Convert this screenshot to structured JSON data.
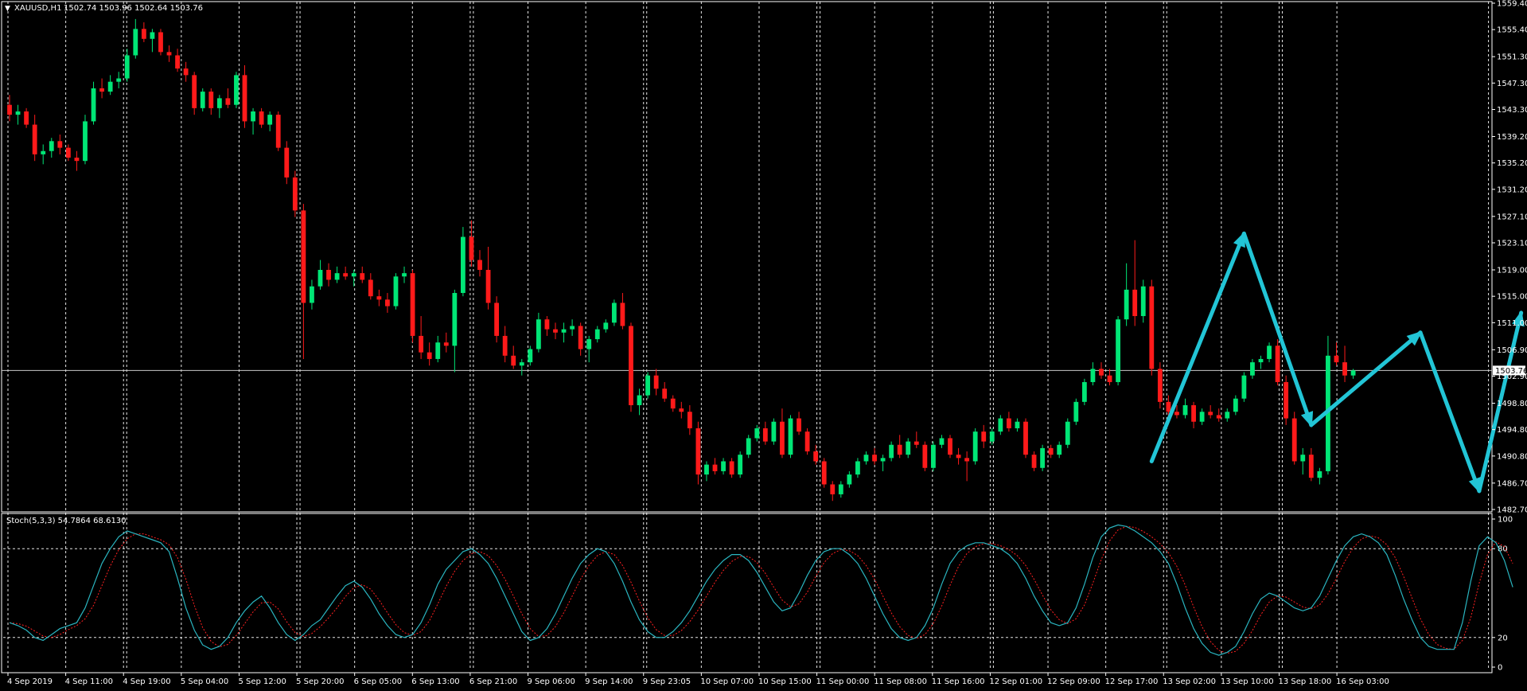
{
  "chart_data": {
    "type": "candlestick",
    "symbol_label": "XAUUSD,H1",
    "ohlc_readout": "1502.74 1503.96 1502.64 1503.76",
    "price_axis": {
      "range": [
        1482.7,
        1559.4
      ],
      "ticks": [
        1482.7,
        1486.7,
        1490.8,
        1494.8,
        1498.8,
        1502.9,
        1506.9,
        1511.0,
        1515.0,
        1519.0,
        1523.1,
        1527.1,
        1531.2,
        1535.2,
        1539.2,
        1543.3,
        1547.3,
        1551.3,
        1555.4,
        1559.4
      ],
      "current_price": 1503.76,
      "current_price_label": "1503.76"
    },
    "time_axis": {
      "labels": [
        "4 Sep 2019",
        "4 Sep 11:00",
        "4 Sep 19:00",
        "5 Sep 04:00",
        "5 Sep 12:00",
        "5 Sep 20:00",
        "6 Sep 05:00",
        "6 Sep 13:00",
        "6 Sep 21:00",
        "9 Sep 06:00",
        "9 Sep 14:00",
        "9 Sep 23:05",
        "10 Sep 07:00",
        "10 Sep 15:00",
        "11 Sep 00:00",
        "11 Sep 08:00",
        "11 Sep 16:00",
        "12 Sep 01:00",
        "12 Sep 09:00",
        "12 Sep 17:00",
        "13 Sep 02:00",
        "13 Sep 10:00",
        "13 Sep 18:00",
        "16 Sep 03:00"
      ],
      "grid_label_indices": [
        2,
        5,
        8,
        11,
        14,
        17,
        20,
        22
      ],
      "extra_grid_after_end": true
    },
    "candles": [
      [
        1544.0,
        1545.5,
        1541.5,
        1542.5
      ],
      [
        1542.5,
        1544.0,
        1541.0,
        1543.0
      ],
      [
        1543.0,
        1543.5,
        1540.5,
        1541.0
      ],
      [
        1541.0,
        1542.5,
        1535.5,
        1536.5
      ],
      [
        1536.5,
        1538.0,
        1535.0,
        1537.0
      ],
      [
        1537.0,
        1539.0,
        1536.0,
        1538.5
      ],
      [
        1538.5,
        1539.5,
        1536.5,
        1537.5
      ],
      [
        1537.5,
        1538.0,
        1535.5,
        1536.0
      ],
      [
        1536.0,
        1537.0,
        1534.0,
        1535.5
      ],
      [
        1535.5,
        1542.5,
        1535.0,
        1541.5
      ],
      [
        1541.5,
        1547.5,
        1541.0,
        1546.5
      ],
      [
        1546.5,
        1548.0,
        1545.0,
        1546.0
      ],
      [
        1546.0,
        1548.5,
        1545.5,
        1547.5
      ],
      [
        1547.5,
        1549.0,
        1546.5,
        1548.0
      ],
      [
        1548.0,
        1552.5,
        1547.5,
        1551.5
      ],
      [
        1551.5,
        1557.0,
        1551.0,
        1555.5
      ],
      [
        1555.5,
        1556.5,
        1553.5,
        1554.0
      ],
      [
        1554.0,
        1555.5,
        1552.0,
        1555.0
      ],
      [
        1555.0,
        1555.5,
        1551.5,
        1552.0
      ],
      [
        1552.0,
        1553.0,
        1550.5,
        1551.5
      ],
      [
        1551.5,
        1552.5,
        1549.0,
        1549.5
      ],
      [
        1549.5,
        1550.5,
        1547.5,
        1548.5
      ],
      [
        1548.5,
        1549.0,
        1542.5,
        1543.5
      ],
      [
        1543.5,
        1546.5,
        1543.0,
        1546.0
      ],
      [
        1546.0,
        1546.5,
        1542.5,
        1543.5
      ],
      [
        1543.5,
        1545.5,
        1542.0,
        1545.0
      ],
      [
        1545.0,
        1546.5,
        1543.5,
        1544.0
      ],
      [
        1544.0,
        1549.0,
        1543.5,
        1548.5
      ],
      [
        1548.5,
        1550.0,
        1540.5,
        1541.5
      ],
      [
        1541.5,
        1543.5,
        1539.5,
        1543.0
      ],
      [
        1543.0,
        1543.5,
        1540.5,
        1541.0
      ],
      [
        1541.0,
        1543.0,
        1540.0,
        1542.5
      ],
      [
        1542.5,
        1543.0,
        1537.0,
        1537.5
      ],
      [
        1537.5,
        1538.5,
        1532.0,
        1533.0
      ],
      [
        1533.0,
        1534.0,
        1527.0,
        1528.0
      ],
      [
        1528.0,
        1529.0,
        1505.5,
        1514.0
      ],
      [
        1514.0,
        1517.5,
        1513.0,
        1516.5
      ],
      [
        1516.5,
        1520.5,
        1516.0,
        1519.0
      ],
      [
        1519.0,
        1520.0,
        1516.5,
        1517.5
      ],
      [
        1517.5,
        1519.5,
        1517.0,
        1518.5
      ],
      [
        1518.5,
        1519.5,
        1517.5,
        1518.0
      ],
      [
        1518.0,
        1519.0,
        1516.5,
        1518.5
      ],
      [
        1518.5,
        1519.5,
        1517.0,
        1517.5
      ],
      [
        1517.5,
        1518.5,
        1514.5,
        1515.0
      ],
      [
        1515.0,
        1516.0,
        1513.5,
        1514.5
      ],
      [
        1514.5,
        1515.5,
        1512.5,
        1513.5
      ],
      [
        1513.5,
        1518.5,
        1513.0,
        1518.0
      ],
      [
        1518.0,
        1519.5,
        1517.0,
        1518.5
      ],
      [
        1518.5,
        1519.0,
        1508.0,
        1509.0
      ],
      [
        1509.0,
        1512.0,
        1505.5,
        1506.5
      ],
      [
        1506.5,
        1508.0,
        1504.5,
        1505.5
      ],
      [
        1505.5,
        1509.0,
        1505.0,
        1508.0
      ],
      [
        1508.0,
        1509.5,
        1506.5,
        1507.5
      ],
      [
        1507.5,
        1516.0,
        1503.5,
        1515.5
      ],
      [
        1515.5,
        1525.5,
        1515.0,
        1524.0
      ],
      [
        1524.0,
        1526.5,
        1519.5,
        1520.5
      ],
      [
        1520.5,
        1522.0,
        1518.0,
        1519.0
      ],
      [
        1519.0,
        1522.5,
        1513.0,
        1514.0
      ],
      [
        1514.0,
        1515.0,
        1508.0,
        1509.0
      ],
      [
        1509.0,
        1510.5,
        1505.0,
        1506.0
      ],
      [
        1506.0,
        1507.5,
        1504.0,
        1504.5
      ],
      [
        1504.5,
        1505.5,
        1503.0,
        1505.0
      ],
      [
        1505.0,
        1507.5,
        1504.5,
        1507.0
      ],
      [
        1507.0,
        1512.5,
        1506.5,
        1511.5
      ],
      [
        1511.5,
        1512.0,
        1509.0,
        1510.0
      ],
      [
        1510.0,
        1511.0,
        1508.5,
        1509.5
      ],
      [
        1509.5,
        1511.0,
        1508.0,
        1510.0
      ],
      [
        1510.0,
        1511.5,
        1509.0,
        1510.5
      ],
      [
        1510.5,
        1511.0,
        1506.0,
        1507.0
      ],
      [
        1507.0,
        1509.0,
        1505.0,
        1508.5
      ],
      [
        1508.5,
        1510.5,
        1508.0,
        1510.0
      ],
      [
        1510.0,
        1511.5,
        1509.5,
        1511.0
      ],
      [
        1511.0,
        1514.5,
        1510.5,
        1514.0
      ],
      [
        1514.0,
        1515.5,
        1510.0,
        1510.5
      ],
      [
        1510.5,
        1511.0,
        1497.5,
        1498.5
      ],
      [
        1498.5,
        1501.0,
        1497.0,
        1500.0
      ],
      [
        1500.0,
        1503.5,
        1499.5,
        1503.0
      ],
      [
        1503.0,
        1504.0,
        1500.0,
        1501.0
      ],
      [
        1501.0,
        1502.0,
        1499.0,
        1499.5
      ],
      [
        1499.5,
        1500.0,
        1497.5,
        1498.0
      ],
      [
        1498.0,
        1499.0,
        1496.5,
        1497.5
      ],
      [
        1497.5,
        1498.5,
        1494.0,
        1495.0
      ],
      [
        1495.0,
        1496.0,
        1486.5,
        1488.0
      ],
      [
        1488.0,
        1490.0,
        1487.0,
        1489.5
      ],
      [
        1489.5,
        1490.5,
        1488.0,
        1488.5
      ],
      [
        1488.5,
        1490.5,
        1488.0,
        1490.0
      ],
      [
        1490.0,
        1490.5,
        1487.5,
        1488.0
      ],
      [
        1488.0,
        1491.5,
        1487.5,
        1491.0
      ],
      [
        1491.0,
        1494.0,
        1490.5,
        1493.5
      ],
      [
        1493.5,
        1495.5,
        1493.0,
        1495.0
      ],
      [
        1495.0,
        1496.0,
        1492.5,
        1493.0
      ],
      [
        1493.0,
        1496.5,
        1492.5,
        1496.0
      ],
      [
        1496.0,
        1498.0,
        1490.5,
        1491.0
      ],
      [
        1491.0,
        1497.0,
        1490.5,
        1496.5
      ],
      [
        1496.5,
        1497.5,
        1494.0,
        1494.5
      ],
      [
        1494.5,
        1495.0,
        1491.0,
        1491.5
      ],
      [
        1491.5,
        1492.5,
        1489.5,
        1490.0
      ],
      [
        1490.0,
        1490.5,
        1486.0,
        1486.5
      ],
      [
        1486.5,
        1487.0,
        1484.0,
        1485.0
      ],
      [
        1485.0,
        1487.0,
        1484.5,
        1486.5
      ],
      [
        1486.5,
        1488.5,
        1486.0,
        1488.0
      ],
      [
        1488.0,
        1490.5,
        1487.5,
        1490.0
      ],
      [
        1490.0,
        1491.5,
        1489.5,
        1491.0
      ],
      [
        1491.0,
        1492.0,
        1489.5,
        1490.0
      ],
      [
        1490.0,
        1491.0,
        1488.5,
        1490.5
      ],
      [
        1490.5,
        1493.0,
        1490.0,
        1492.5
      ],
      [
        1492.5,
        1494.0,
        1490.5,
        1491.0
      ],
      [
        1491.0,
        1493.5,
        1490.5,
        1493.0
      ],
      [
        1493.0,
        1494.5,
        1492.0,
        1492.5
      ],
      [
        1492.5,
        1493.0,
        1488.5,
        1489.0
      ],
      [
        1489.0,
        1493.0,
        1488.5,
        1492.5
      ],
      [
        1492.5,
        1494.0,
        1492.0,
        1493.5
      ],
      [
        1493.5,
        1494.0,
        1490.5,
        1491.0
      ],
      [
        1491.0,
        1492.0,
        1489.5,
        1490.5
      ],
      [
        1490.5,
        1491.5,
        1487.0,
        1490.0
      ],
      [
        1490.0,
        1495.0,
        1489.5,
        1494.5
      ],
      [
        1494.5,
        1495.5,
        1492.0,
        1493.0
      ],
      [
        1493.0,
        1495.0,
        1492.5,
        1494.5
      ],
      [
        1494.5,
        1497.0,
        1494.0,
        1496.5
      ],
      [
        1496.5,
        1497.5,
        1494.5,
        1495.0
      ],
      [
        1495.0,
        1496.5,
        1494.5,
        1496.0
      ],
      [
        1496.0,
        1496.5,
        1490.5,
        1491.0
      ],
      [
        1491.0,
        1491.5,
        1488.5,
        1489.0
      ],
      [
        1489.0,
        1492.5,
        1488.5,
        1492.0
      ],
      [
        1492.0,
        1492.5,
        1490.5,
        1491.0
      ],
      [
        1491.0,
        1493.0,
        1490.5,
        1492.5
      ],
      [
        1492.5,
        1496.5,
        1492.0,
        1496.0
      ],
      [
        1496.0,
        1499.5,
        1495.5,
        1499.0
      ],
      [
        1499.0,
        1502.5,
        1498.5,
        1502.0
      ],
      [
        1502.0,
        1505.0,
        1501.5,
        1504.0
      ],
      [
        1504.0,
        1505.0,
        1502.5,
        1503.0
      ],
      [
        1503.0,
        1504.0,
        1501.5,
        1502.0
      ],
      [
        1502.0,
        1512.0,
        1501.5,
        1511.5
      ],
      [
        1511.5,
        1520.0,
        1510.5,
        1516.0
      ],
      [
        1516.0,
        1523.5,
        1510.5,
        1512.0
      ],
      [
        1512.0,
        1517.5,
        1511.0,
        1516.5
      ],
      [
        1516.5,
        1517.5,
        1503.0,
        1504.0
      ],
      [
        1504.0,
        1505.0,
        1498.0,
        1499.0
      ],
      [
        1499.0,
        1500.0,
        1496.5,
        1497.5
      ],
      [
        1497.5,
        1498.5,
        1496.5,
        1497.0
      ],
      [
        1497.0,
        1499.5,
        1496.5,
        1498.5
      ],
      [
        1498.5,
        1499.0,
        1495.0,
        1496.0
      ],
      [
        1496.0,
        1498.0,
        1495.5,
        1497.5
      ],
      [
        1497.5,
        1498.5,
        1496.5,
        1497.0
      ],
      [
        1497.0,
        1498.0,
        1496.0,
        1496.5
      ],
      [
        1496.5,
        1498.0,
        1496.0,
        1497.5
      ],
      [
        1497.5,
        1500.0,
        1497.0,
        1499.5
      ],
      [
        1499.5,
        1503.5,
        1499.0,
        1503.0
      ],
      [
        1503.0,
        1505.5,
        1502.5,
        1505.0
      ],
      [
        1505.0,
        1506.0,
        1504.0,
        1505.5
      ],
      [
        1505.5,
        1508.0,
        1505.0,
        1507.5
      ],
      [
        1507.5,
        1508.5,
        1501.5,
        1502.0
      ],
      [
        1502.0,
        1503.0,
        1495.5,
        1496.5
      ],
      [
        1496.5,
        1497.5,
        1489.5,
        1490.0
      ],
      [
        1490.0,
        1492.0,
        1488.0,
        1491.0
      ],
      [
        1491.0,
        1492.0,
        1487.0,
        1487.5
      ],
      [
        1487.5,
        1489.0,
        1486.5,
        1488.5
      ],
      [
        1488.5,
        1509.0,
        1488.0,
        1506.0
      ],
      [
        1506.0,
        1508.0,
        1504.5,
        1505.0
      ],
      [
        1505.0,
        1507.5,
        1502.0,
        1503.0
      ],
      [
        1503.0,
        1504.0,
        1502.5,
        1503.76
      ]
    ],
    "annotations": [
      {
        "type": "arrow-polyline",
        "color": "#22c5d6",
        "points": [
          [
            136,
            1490.0
          ],
          [
            147,
            1524.5
          ]
        ]
      },
      {
        "type": "arrow-polyline",
        "color": "#22c5d6",
        "points": [
          [
            147,
            1524.5
          ],
          [
            155,
            1495.5
          ]
        ]
      },
      {
        "type": "arrow-polyline",
        "color": "#22c5d6",
        "points": [
          [
            155,
            1495.5
          ],
          [
            168,
            1509.5
          ]
        ]
      },
      {
        "type": "arrow-polyline",
        "color": "#22c5d6",
        "points": [
          [
            168,
            1509.5
          ],
          [
            175,
            1485.5
          ]
        ]
      },
      {
        "type": "arrow-polyline",
        "color": "#22c5d6",
        "points": [
          [
            175,
            1485.5
          ],
          [
            180,
            1512.5
          ]
        ]
      }
    ],
    "stochastic": {
      "label": "Stoch(5,3,3) 54.7864 68.6130",
      "range": [
        0,
        100
      ],
      "levels": [
        20,
        80
      ],
      "tick_labels": [
        "100",
        "80",
        "20",
        "0"
      ],
      "main_color": "#2ab5c0",
      "signal_color": "#ff2020",
      "main": [
        30,
        28,
        25,
        20,
        18,
        22,
        26,
        28,
        30,
        40,
        55,
        70,
        80,
        88,
        92,
        90,
        88,
        86,
        84,
        78,
        60,
        40,
        25,
        15,
        12,
        14,
        20,
        30,
        38,
        44,
        48,
        40,
        30,
        22,
        18,
        22,
        28,
        32,
        40,
        48,
        55,
        58,
        54,
        46,
        36,
        28,
        22,
        20,
        22,
        30,
        42,
        56,
        66,
        72,
        78,
        80,
        76,
        70,
        60,
        48,
        36,
        24,
        18,
        20,
        26,
        36,
        48,
        60,
        70,
        76,
        80,
        78,
        70,
        58,
        44,
        32,
        24,
        20,
        20,
        24,
        30,
        38,
        48,
        58,
        66,
        72,
        76,
        76,
        72,
        64,
        54,
        44,
        38,
        40,
        50,
        62,
        72,
        78,
        80,
        80,
        76,
        70,
        60,
        48,
        36,
        26,
        20,
        18,
        20,
        28,
        40,
        56,
        70,
        78,
        82,
        84,
        84,
        82,
        80,
        76,
        70,
        60,
        48,
        38,
        30,
        28,
        30,
        40,
        56,
        74,
        88,
        94,
        96,
        95,
        92,
        88,
        84,
        78,
        70,
        56,
        40,
        26,
        16,
        10,
        8,
        10,
        14,
        24,
        36,
        46,
        50,
        48,
        44,
        40,
        38,
        40,
        48,
        60,
        72,
        82,
        88,
        90,
        88,
        84,
        76,
        62,
        46,
        32,
        20,
        14,
        12,
        12,
        12,
        30,
        58,
        82,
        88,
        84,
        72,
        54
      ]
    },
    "colors": {
      "background": "#000000",
      "bull": "#00e676",
      "bear": "#ff1a1a",
      "axis": "#ffffff",
      "grid": "#ffffff"
    }
  }
}
